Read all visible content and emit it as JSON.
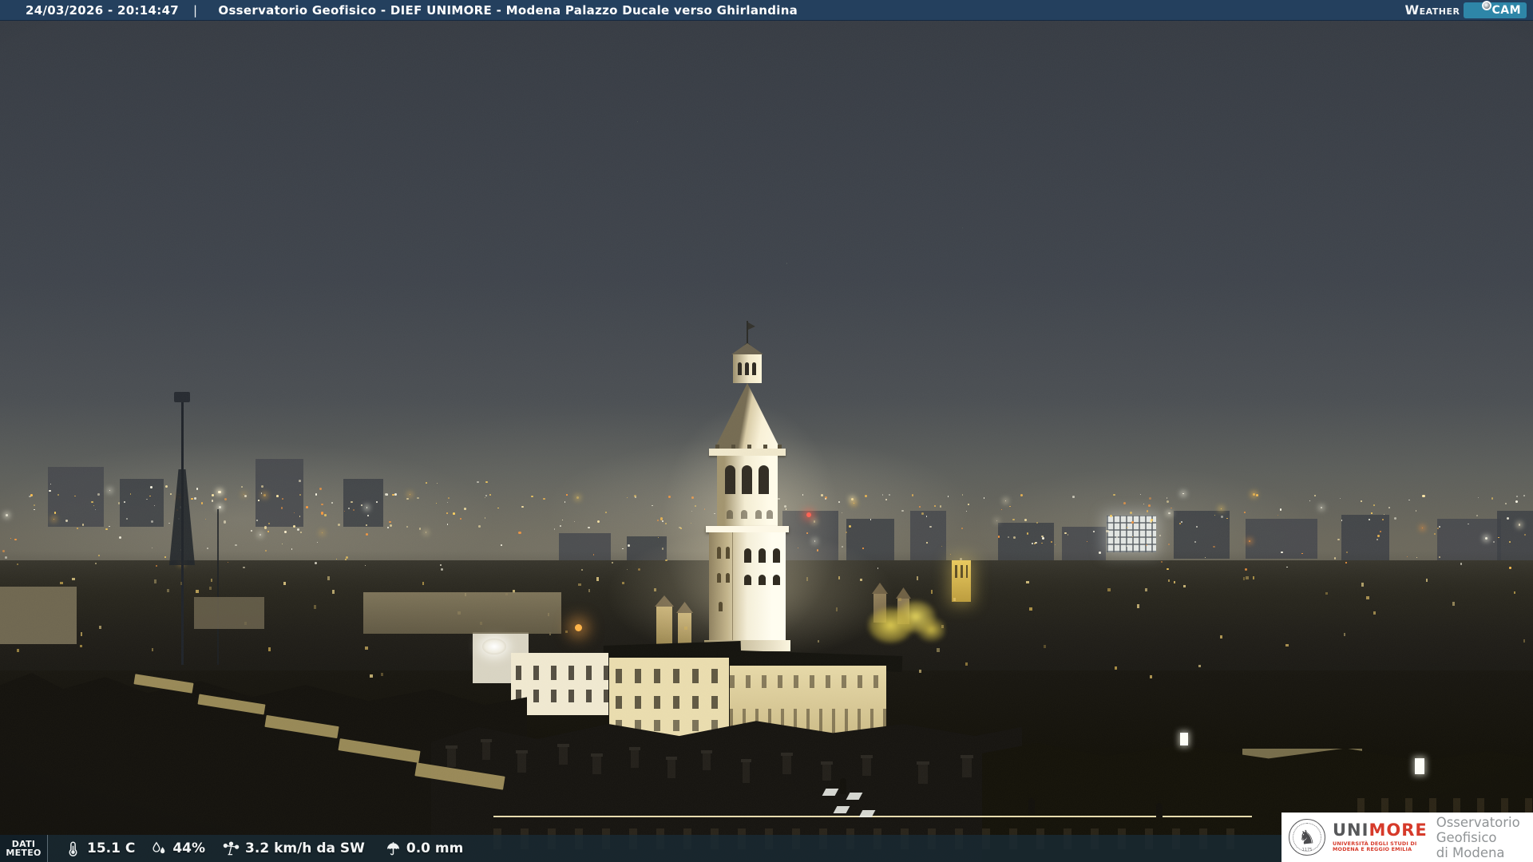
{
  "header": {
    "timestamp": "24/03/2026 - 20:14:47",
    "separator": "|",
    "title": "Osservatorio Geofisico - DIEF UNIMORE - Modena Palazzo Ducale verso Ghirlandina",
    "brand": {
      "weather": "Weather",
      "cam": "CAM"
    }
  },
  "footer": {
    "label_line1": "DATI",
    "label_line2": "METEO",
    "readings": [
      {
        "icon": "thermometer-icon",
        "value": "15.1 C"
      },
      {
        "icon": "humidity-icon",
        "value": "44%"
      },
      {
        "icon": "anemometer-icon",
        "value": "3.2 km/h da SW"
      },
      {
        "icon": "umbrella-icon",
        "value": "0.0 mm"
      }
    ]
  },
  "logo_box": {
    "acronym_uni": "UNI",
    "acronym_more": "MORE",
    "subtitle_line1": "UNIVERSITÀ DEGLI STUDI DI",
    "subtitle_line2": "MODENA E REGGIO EMILIA",
    "seal_year": "1175",
    "org_line1": "Osservatorio Geofisico",
    "org_line2": "di Modena"
  },
  "colors": {
    "topbar_bg": "#24405e",
    "badge_teal": "#2e86a8",
    "footer_bg": "rgba(25,42,53,0.8)",
    "unimore_red": "#d63a2a",
    "unimore_gray": "#57585a",
    "org_gray": "#909496"
  },
  "scene_colors": {
    "sky_top": "#363b43",
    "sky_mid": "#3f444c",
    "sky_low": "#4b4f53",
    "sky_horizon": "#5d5f5b",
    "tower_lit": "#fefae8",
    "tower_shade": "#a2946f",
    "window_warm": "#f2cf6f"
  }
}
